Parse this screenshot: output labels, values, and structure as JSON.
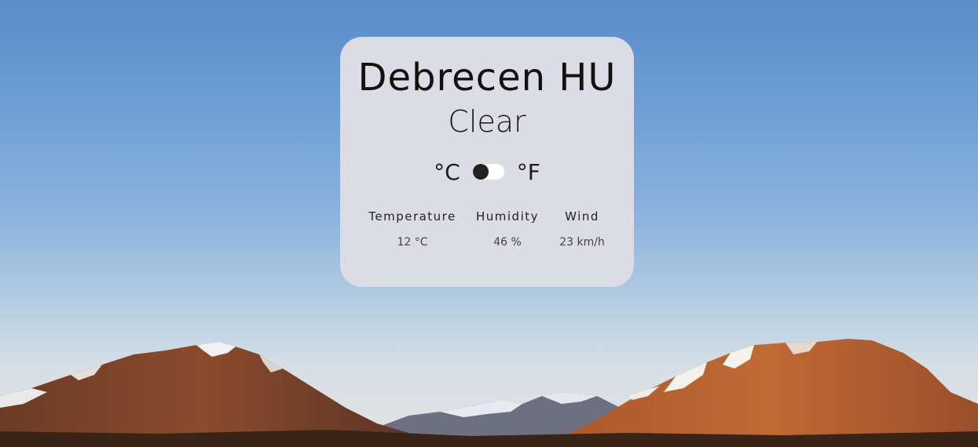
{
  "weather": {
    "city": "Debrecen HU",
    "condition": "Clear",
    "units": {
      "celsius_label": "°C",
      "fahrenheit_label": "°F",
      "selected": "celsius"
    },
    "stats": [
      {
        "label": "Temperature",
        "value": "12 °C"
      },
      {
        "label": "Humidity",
        "value": "46 %"
      },
      {
        "label": "Wind",
        "value": "23 km/h"
      }
    ]
  },
  "colors": {
    "card_background": "#dcdce4",
    "toggle_track": "#ffffff",
    "toggle_knob": "#222222",
    "sky_top": "#5b8cc8",
    "sky_bottom": "#e3e3e0",
    "mountain": "#8a4a2e"
  }
}
